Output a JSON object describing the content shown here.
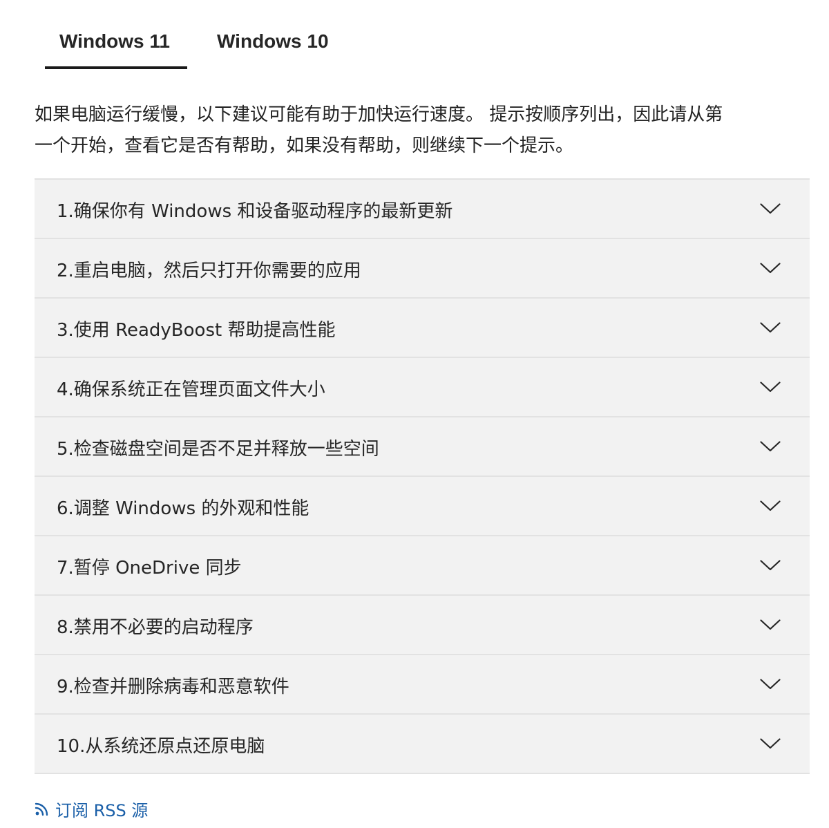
{
  "tabs": [
    {
      "label": "Windows 11",
      "active": true
    },
    {
      "label": "Windows 10",
      "active": false
    }
  ],
  "intro_lines": [
    "如果电脑运行缓慢，以下建议可能有助于加快运行速度。 提示按顺序列出，因此请从第",
    "一个开始，查看它是否有帮助，如果没有帮助，则继续下一个提示。"
  ],
  "accordion": {
    "items": [
      {
        "label": "1.确保你有 Windows 和设备驱动程序的最新更新"
      },
      {
        "label": "2.重启电脑，然后只打开你需要的应用"
      },
      {
        "label": "3.使用 ReadyBoost 帮助提高性能"
      },
      {
        "label": "4.确保系统正在管理页面文件大小"
      },
      {
        "label": "5.检查磁盘空间是否不足并释放一些空间"
      },
      {
        "label": "6.调整 Windows 的外观和性能"
      },
      {
        "label": "7.暂停 OneDrive 同步"
      },
      {
        "label": "8.禁用不必要的启动程序"
      },
      {
        "label": "9.检查并删除病毒和恶意软件"
      },
      {
        "label": "10.从系统还原点还原电脑"
      }
    ],
    "expand_icon": "chevron-down-icon"
  },
  "footer": {
    "rss_label": "订阅 RSS 源",
    "rss_icon": "rss-icon",
    "link_color": "#1a5fa8"
  },
  "colors": {
    "item_background": "#f2f2f2",
    "divider": "#e2e2e2",
    "active_tab_underline": "#1a1a1a"
  }
}
